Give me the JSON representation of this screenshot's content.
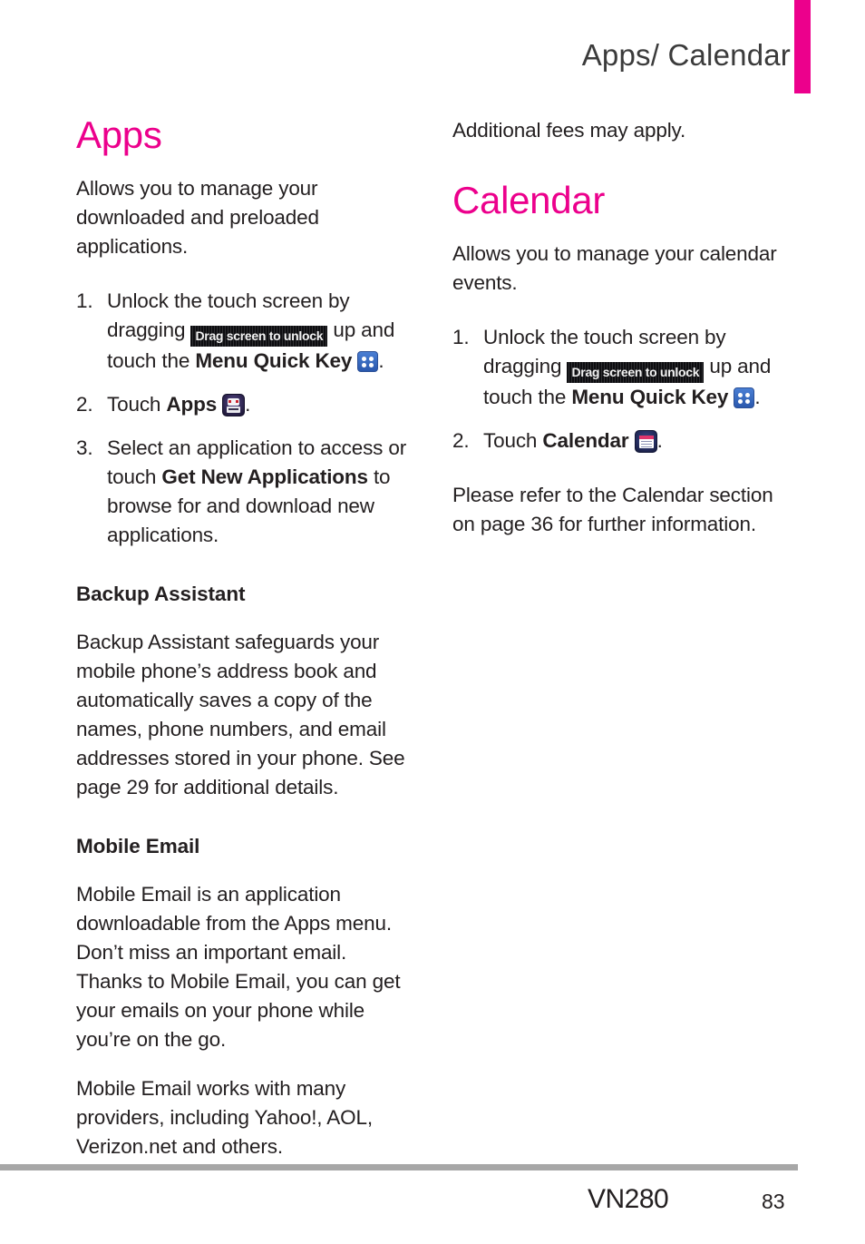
{
  "header": {
    "title": "Apps/ Calendar",
    "accent_color": "#ec008c"
  },
  "left_column": {
    "section_title": "Apps",
    "lead": "Allows you to manage your downloaded and preloaded applications.",
    "steps": [
      {
        "num": "1.",
        "part1": "Unlock the touch screen by dragging ",
        "badge": "Drag screen to unlock",
        "part2": " up and touch the ",
        "bold": "Menu Quick Key",
        "icon": "menu-quick-key-icon",
        "part3": "."
      },
      {
        "num": "2.",
        "part1": "Touch ",
        "bold": "Apps",
        "icon": "apps-icon",
        "part3": "."
      },
      {
        "num": "3.",
        "part1": "Select an application to access or touch ",
        "bold": "Get New Applications",
        "part3": " to browse for and download new applications."
      }
    ],
    "subsections": [
      {
        "title": "Backup Assistant",
        "body": "Backup Assistant safeguards your mobile phone’s address book and automatically saves a copy of the names, phone numbers, and email addresses stored in your phone. See page 29 for additional details."
      },
      {
        "title": "Mobile Email",
        "body": "Mobile Email is an application downloadable from the Apps menu. Don’t miss an important email. Thanks to Mobile Email, you can get your emails on your phone while you’re on the go.",
        "body2": "Mobile Email works with many providers, including Yahoo!, AOL, Verizon.net and others."
      }
    ]
  },
  "right_column": {
    "intro": "Additional fees may apply.",
    "section_title": "Calendar",
    "lead": "Allows you to manage your calendar events.",
    "steps": [
      {
        "num": "1.",
        "part1": "Unlock the touch screen by dragging ",
        "badge": "Drag screen to unlock",
        "part2": " up and touch the ",
        "bold": "Menu Quick Key",
        "icon": "menu-quick-key-icon",
        "part3": "."
      },
      {
        "num": "2.",
        "part1": "Touch ",
        "bold": "Calendar",
        "icon": "calendar-icon",
        "part3": "."
      }
    ],
    "closing": "Please refer to the Calendar section on page 36 for further information."
  },
  "footer": {
    "model": "VN280",
    "page_number": "83"
  }
}
